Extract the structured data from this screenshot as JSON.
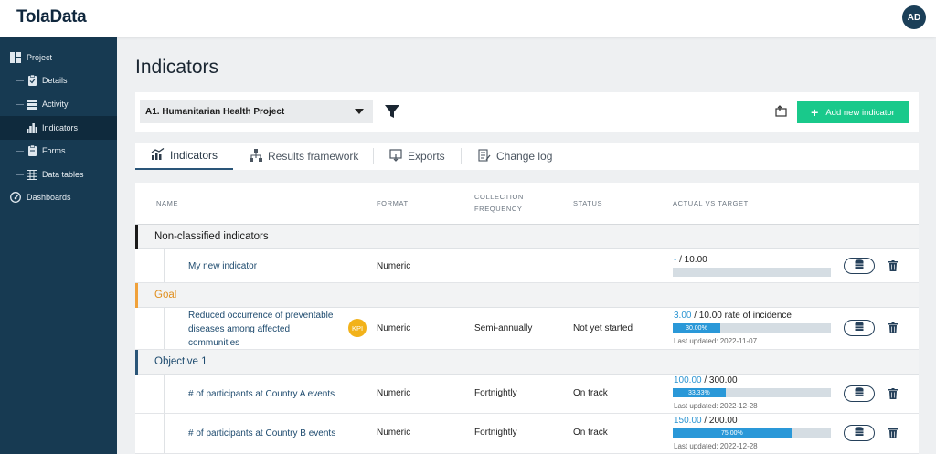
{
  "app": {
    "logo": "ToIaData",
    "avatar_initials": "AD"
  },
  "sidebar": {
    "items": [
      {
        "label": "Project",
        "icon": "project-icon"
      },
      {
        "label": "Details",
        "icon": "clipboard-icon"
      },
      {
        "label": "Activity",
        "icon": "activity-icon"
      },
      {
        "label": "Indicators",
        "icon": "bar-chart-icon",
        "active": true
      },
      {
        "label": "Forms",
        "icon": "forms-icon"
      },
      {
        "label": "Data tables",
        "icon": "table-icon"
      },
      {
        "label": "Dashboards",
        "icon": "dashboard-icon"
      }
    ]
  },
  "page": {
    "title": "Indicators"
  },
  "toolbar": {
    "project_select": "A1. Humanitarian Health Project",
    "add_button": "Add new indicator"
  },
  "tabs": [
    {
      "label": "Indicators",
      "icon": "indicators-tab-icon",
      "active": true
    },
    {
      "label": "Results framework",
      "icon": "hierarchy-icon"
    },
    {
      "label": "Exports",
      "icon": "export-icon"
    },
    {
      "label": "Change log",
      "icon": "change-log-icon"
    }
  ],
  "table": {
    "headers": {
      "name": "NAME",
      "format": "FORMAT",
      "frequency_1": "COLLECTION",
      "frequency_2": "FREQUENCY",
      "status": "STATUS",
      "actual_vs_target": "ACTUAL VS TARGET"
    },
    "groups": [
      {
        "label": "Non-classified indicators",
        "color": "#1a1a1a"
      },
      {
        "label": "Goal",
        "color": "#f0a13a"
      },
      {
        "label": "Objective 1",
        "color": "#2a5578"
      }
    ],
    "rows": [
      {
        "name": "My new indicator",
        "format": "Numeric",
        "frequency": "",
        "status": "",
        "actual": "-",
        "target_text": " / 10.00",
        "progress": 0,
        "progress_label": "",
        "updated": ""
      },
      {
        "name_lines": [
          "Reduced occurrence of preventable",
          "diseases among affected",
          "communities"
        ],
        "kpi": "KPI",
        "format": "Numeric",
        "frequency": "Semi-annually",
        "status": "Not yet started",
        "actual": "3.00",
        "target_text": " / 10.00 rate of incidence",
        "progress": 0.3,
        "progress_label": "30.00%",
        "updated": "Last updated: 2022-11-07"
      },
      {
        "name": "# of participants at Country A events",
        "format": "Numeric",
        "frequency": "Fortnightly",
        "status": "On track",
        "actual": "100.00",
        "target_text": " / 300.00",
        "progress": 0.3333,
        "progress_label": "33.33%",
        "updated": "Last updated: 2022-12-28"
      },
      {
        "name": "# of participants at Country B events",
        "format": "Numeric",
        "frequency": "Fortnightly",
        "status": "On track",
        "actual": "150.00",
        "target_text": " / 200.00",
        "progress": 0.75,
        "progress_label": "75.00%",
        "updated": "Last updated: 2022-12-28"
      }
    ]
  }
}
